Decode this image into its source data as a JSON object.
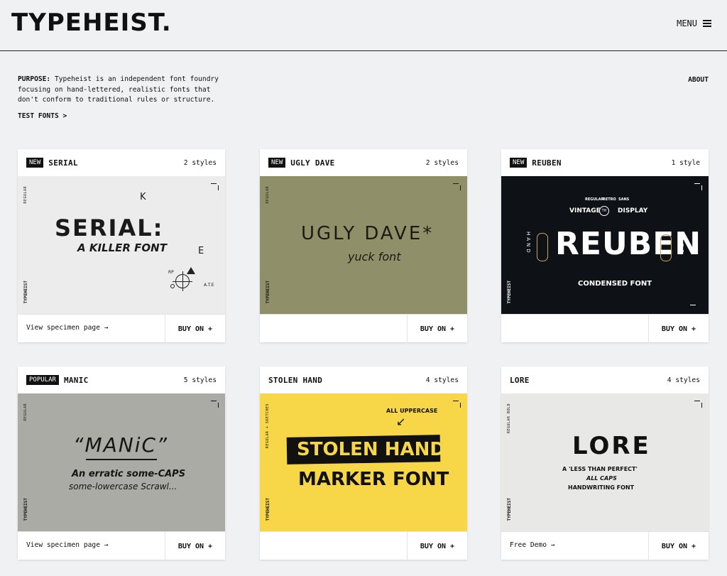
{
  "header": {
    "logo": "TYPEHEIST.",
    "menu_label": "MENU"
  },
  "intro": {
    "label": "PURPOSE:",
    "text": "Typeheist is an independent font foundry focusing on hand-lettered, realistic fonts that don't conform to traditional rules or structure.",
    "test_link": "TEST FONTS >",
    "about": "ABOUT"
  },
  "cards": [
    {
      "badge": "NEW",
      "title": "SERIAL",
      "styles": "2 styles",
      "foot_link": "View specimen page →",
      "buy": "BUY ON +",
      "bg": "#ececec",
      "vert_label": "REGULAR",
      "brand": "TYPEHEIST",
      "art": {
        "main": "SERIAL:",
        "sub": "A KILLER FONT",
        "k": "K",
        "e": "E",
        "rp": "RP",
        "ate": "A.T.E"
      }
    },
    {
      "badge": "NEW",
      "title": "UGLY DAVE",
      "styles": "2 styles",
      "foot_link": "",
      "buy": "BUY ON +",
      "bg": "#8f8f6a",
      "vert_label": "REGULAR",
      "brand": "TYPEHEIST",
      "art": {
        "main": "UGLY DAVE*",
        "sub": "yuck font"
      }
    },
    {
      "badge": "NEW",
      "title": "REUBEN",
      "styles": "1 style",
      "foot_link": "",
      "buy": "BUY ON +",
      "bg": "#0e1116",
      "vert_label": "",
      "brand": "TYPEHEIST",
      "art": {
        "top1": "REGULAR",
        "top2": "RETRO",
        "top3": "SANS",
        "vintage": "VINTAGE",
        "th": "TH",
        "display": "DISPLAY",
        "main": "REUBEN",
        "sub": "CONDENSED FONT",
        "left_vert": "HAND",
        "right_vert": "MADE"
      }
    },
    {
      "badge": "POPULAR",
      "title": "MANIC",
      "styles": "5 styles",
      "foot_link": "View specimen page →",
      "buy": "BUY ON +",
      "bg": "#ababa5",
      "vert_label": "REGULAR",
      "brand": "TYPEHEIST",
      "art": {
        "main": "“MANiC”",
        "sub1": "An erratic some-CAPS",
        "sub2": "some-lowercase Scrawl..."
      }
    },
    {
      "badge": "",
      "title": "STOLEN HAND",
      "styles": "4 styles",
      "foot_link": "",
      "buy": "BUY ON +",
      "bg": "#f7d747",
      "vert_label": "REGULAR + SKETCHES",
      "brand": "TYPEHEIST",
      "art": {
        "note": "ALL UPPERCASE",
        "main": "STOLEN HAND",
        "sub": "MARKER FONT"
      }
    },
    {
      "badge": "",
      "title": "LORE",
      "styles": "4 styles",
      "foot_link": "Free Demo →",
      "buy": "BUY ON +",
      "bg": "#e8e9e6",
      "vert_label": "REGULAR  BOLD",
      "brand": "TYPEHEIST",
      "art": {
        "main": "LORE",
        "sub1": "A 'LESS THAN PERFECT'",
        "sub2": "ALL CAPS",
        "sub3": "HANDWRITING FONT"
      }
    }
  ]
}
